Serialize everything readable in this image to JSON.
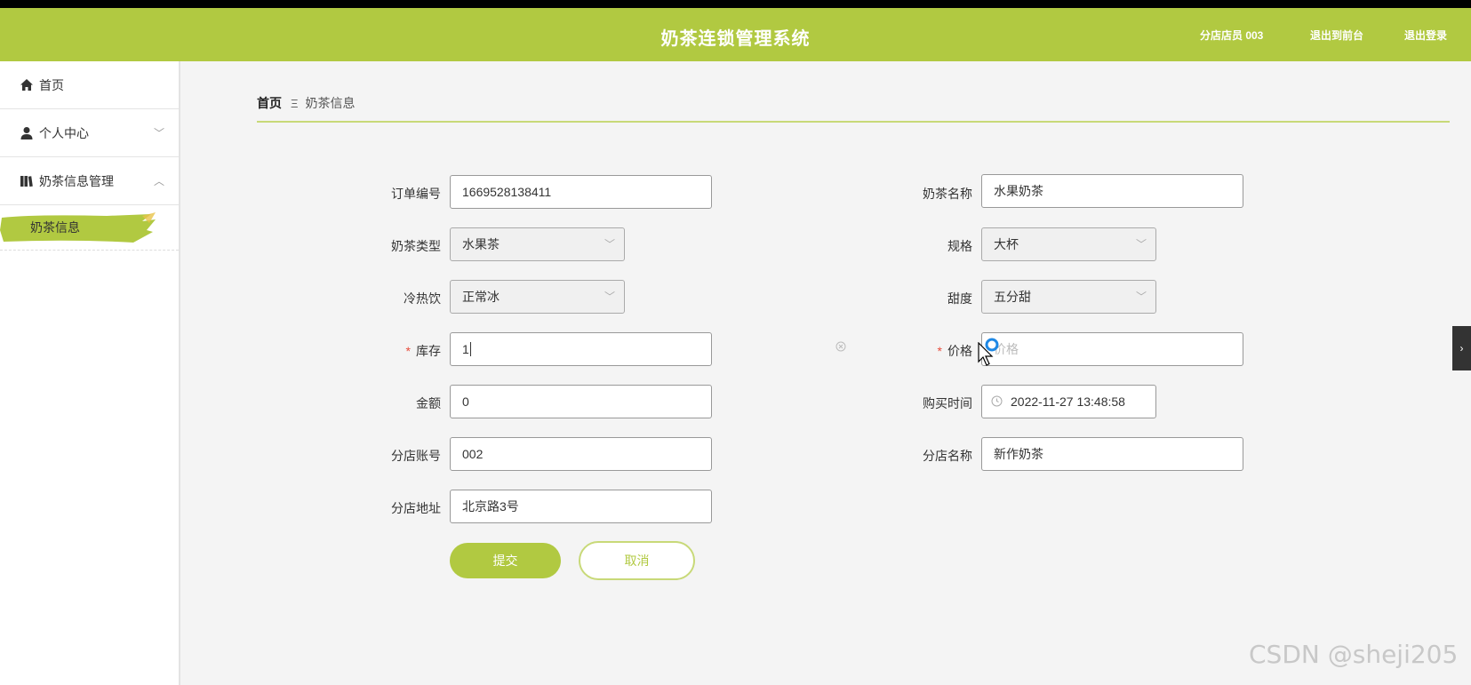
{
  "header": {
    "title": "奶茶连锁管理系统",
    "user_label": "分店店员 003",
    "exit_console": "退出到前台",
    "logout": "退出登录"
  },
  "sidebar": {
    "home": "首页",
    "personal_center": "个人中心",
    "milk_tea_mgmt": "奶茶信息管理",
    "milk_tea_info": "奶茶信息"
  },
  "breadcrumb": {
    "home": "首页",
    "separator": "Ξ",
    "current": "奶茶信息"
  },
  "form": {
    "order_no": {
      "label": "订单编号",
      "value": "1669528138411"
    },
    "tea_name": {
      "label": "奶茶名称",
      "value": "水果奶茶"
    },
    "tea_type": {
      "label": "奶茶类型",
      "value": "水果茶"
    },
    "spec": {
      "label": "规格",
      "value": "大杯"
    },
    "temperature": {
      "label": "冷热饮",
      "value": "正常冰"
    },
    "sweetness": {
      "label": "甜度",
      "value": "五分甜"
    },
    "stock": {
      "label": "库存",
      "value": "1",
      "required_mark": "*"
    },
    "price": {
      "label": "价格",
      "placeholder": "价格",
      "required_mark": "*"
    },
    "amount": {
      "label": "金额",
      "value": "0"
    },
    "purchase_time": {
      "label": "购买时间",
      "value": "2022-11-27 13:48:58"
    },
    "branch_account": {
      "label": "分店账号",
      "value": "002"
    },
    "branch_name": {
      "label": "分店名称",
      "value": "新作奶茶"
    },
    "branch_address": {
      "label": "分店地址",
      "value": "北京路3号"
    }
  },
  "buttons": {
    "submit": "提交",
    "cancel": "取消"
  },
  "watermark": "CSDN @sheji205",
  "colors": {
    "accent": "#b1c941",
    "required": "#e74c3c"
  }
}
